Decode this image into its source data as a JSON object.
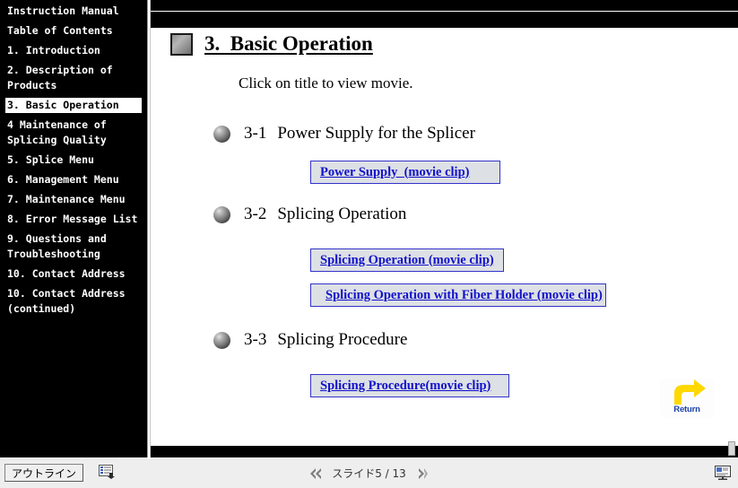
{
  "outline": {
    "items": [
      {
        "label": "Instruction Manual",
        "selected": false
      },
      {
        "label": "Table of Contents",
        "selected": false
      },
      {
        "label": "1.  Introduction",
        "selected": false
      },
      {
        "label": "2.  Description of Products",
        "selected": false
      },
      {
        "label": "3.  Basic Operation",
        "selected": true
      },
      {
        "label": "4 Maintenance of Splicing Quality",
        "selected": false
      },
      {
        "label": "5.  Splice Menu",
        "selected": false
      },
      {
        "label": "6.  Management Menu",
        "selected": false
      },
      {
        "label": "7.  Maintenance Menu",
        "selected": false
      },
      {
        "label": "8.  Error Message List",
        "selected": false
      },
      {
        "label": "9.  Questions and Troubleshooting",
        "selected": false
      },
      {
        "label": "10.  Contact Address",
        "selected": false
      },
      {
        "label": "10.  Contact Address (continued)",
        "selected": false
      }
    ]
  },
  "slide": {
    "title": "3.  Basic Operation",
    "subtitle": "Click on title to view movie.",
    "sections": [
      {
        "number": "3-1",
        "heading": "Power Supply for the Splicer",
        "clips": [
          {
            "label": "Power Supply  (movie clip)"
          }
        ]
      },
      {
        "number": "3-2",
        "heading": "Splicing Operation",
        "clips": [
          {
            "label": "Splicing Operation (movie clip)"
          },
          {
            "label": "Splicing Operation with Fiber Holder (movie clip)"
          }
        ]
      },
      {
        "number": "3-3",
        "heading": "Splicing Procedure",
        "clips": [
          {
            "label": "Splicing Procedure(movie clip)"
          }
        ]
      }
    ],
    "return_button": {
      "label": "Return",
      "icon": "return-arrow-icon",
      "arrow_color": "#ffd800",
      "label_color": "#1b40a8"
    }
  },
  "status_bar": {
    "outline_tab_label": "アウトライン",
    "view_icon": "outline-view-icon",
    "slide_counter": "スライド5 / 13",
    "prev_icon": "prev-slide-icon",
    "next_icon": "next-slide-icon",
    "show_icon": "slide-show-icon"
  },
  "colors": {
    "link": "#1111cc",
    "link_box_bg": "#dde0e4",
    "link_box_border": "#3333cc",
    "outline_bg": "#000000",
    "outline_text": "#ffffff",
    "slide_bg": "#ffffff"
  }
}
